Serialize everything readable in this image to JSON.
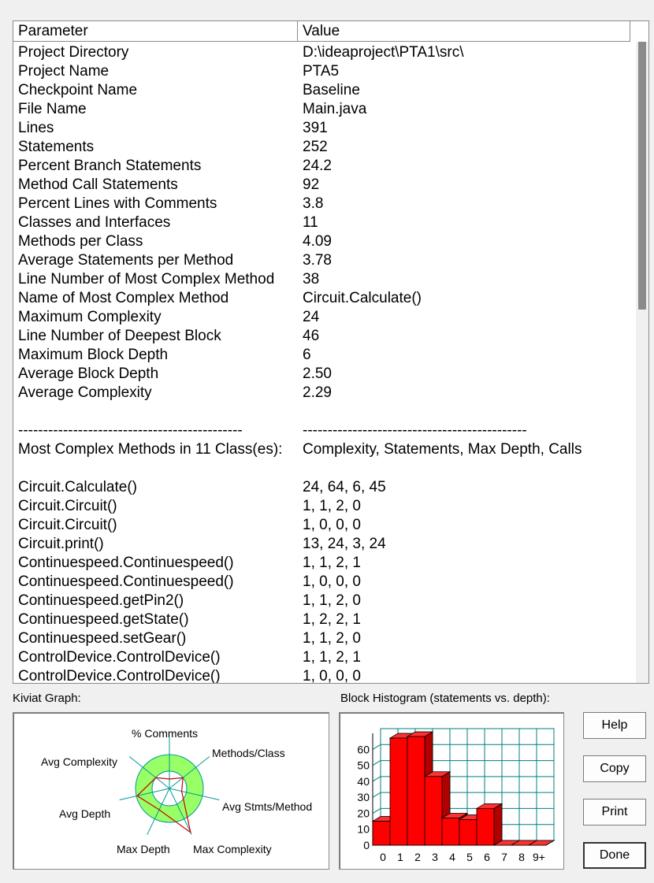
{
  "table": {
    "headers": [
      "Parameter",
      "Value"
    ],
    "rows": [
      [
        "Project Directory",
        "D:\\ideaproject\\PTA1\\src\\"
      ],
      [
        "Project Name",
        "PTA5"
      ],
      [
        "Checkpoint Name",
        "Baseline"
      ],
      [
        "File Name",
        "Main.java"
      ],
      [
        "Lines",
        "391"
      ],
      [
        "Statements",
        "252"
      ],
      [
        "Percent Branch Statements",
        "24.2"
      ],
      [
        "Method Call Statements",
        "92"
      ],
      [
        "Percent Lines with Comments",
        "3.8"
      ],
      [
        "Classes and Interfaces",
        "11"
      ],
      [
        "Methods per Class",
        "4.09"
      ],
      [
        "Average Statements per Method",
        "3.78"
      ],
      [
        "Line Number of Most Complex Method",
        "38"
      ],
      [
        "Name of Most Complex Method",
        "Circuit.Calculate()"
      ],
      [
        "Maximum Complexity",
        "24"
      ],
      [
        "Line Number of Deepest Block",
        "46"
      ],
      [
        "Maximum Block Depth",
        "6"
      ],
      [
        "Average Block Depth",
        "2.50"
      ],
      [
        "Average Complexity",
        "2.29"
      ],
      [
        "",
        ""
      ],
      [
        "---------------------------------------------",
        "---------------------------------------------"
      ],
      [
        "Most Complex Methods in 11 Class(es):",
        "Complexity, Statements, Max Depth, Calls"
      ],
      [
        "",
        ""
      ],
      [
        "Circuit.Calculate()",
        "24, 64, 6, 45"
      ],
      [
        "Circuit.Circuit()",
        "1, 1, 2, 0"
      ],
      [
        "Circuit.Circuit()",
        "1, 0, 0, 0"
      ],
      [
        "Circuit.print()",
        "13, 24, 3, 24"
      ],
      [
        "Continuespeed.Continuespeed()",
        "1, 1, 2, 1"
      ],
      [
        "Continuespeed.Continuespeed()",
        "1, 0, 0, 0"
      ],
      [
        "Continuespeed.getPin2()",
        "1, 1, 2, 0"
      ],
      [
        "Continuespeed.getState()",
        "1, 2, 2, 1"
      ],
      [
        "Continuespeed.setGear()",
        "1, 1, 2, 0"
      ],
      [
        "ControlDevice.ControlDevice()",
        "1, 1, 2, 1"
      ],
      [
        "ControlDevice.ControlDevice()",
        "1, 0, 0, 0"
      ]
    ]
  },
  "kiviat": {
    "label": "Kiviat Graph:",
    "axes": [
      "% Comments",
      "Methods/Class",
      "Avg Stmts/Method",
      "Max Complexity",
      "Max Depth",
      "Avg Depth",
      "Avg Complexity"
    ],
    "colors": {
      "band": "#99ff66",
      "polygon": "#cc0000",
      "axis": "#009999"
    }
  },
  "chart_data": {
    "type": "bar",
    "title": "Block Histogram (statements vs. depth):",
    "categories": [
      "0",
      "1",
      "2",
      "3",
      "4",
      "5",
      "6",
      "7",
      "8",
      "9+"
    ],
    "values": [
      15,
      67,
      68,
      43,
      17,
      16,
      23,
      0,
      0,
      0
    ],
    "yticks": [
      0,
      10,
      20,
      30,
      40,
      50,
      60
    ],
    "ylim": [
      0,
      70
    ],
    "color": "#ff0000",
    "grid": true,
    "grid_color": "#007f7f"
  },
  "buttons": {
    "help": "Help",
    "copy": "Copy",
    "print": "Print",
    "done": "Done"
  }
}
